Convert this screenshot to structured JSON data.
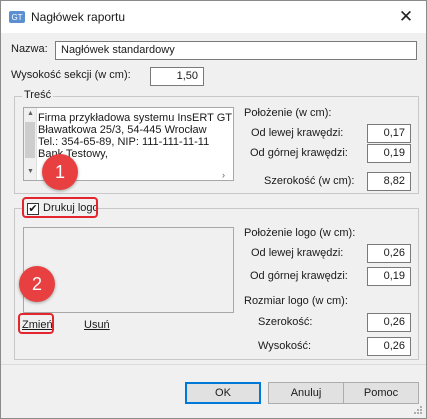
{
  "window": {
    "title": "Nagłówek raportu",
    "close_glyph": "✕",
    "app_icon": "app-icon"
  },
  "header": {
    "name_label": "Nazwa:",
    "name_value": "Nagłówek standardowy",
    "height_label": "Wysokość sekcji (w cm):",
    "height_value": "1,50"
  },
  "content": {
    "legend": "Treść",
    "lines": [
      "Firma przykładowa systemu InsERT GT",
      "Bławatkowa 25/3, 54-445 Wrocław",
      "Tel.: 354-65-89, NIP: 111-111-11-11",
      "Bank Testowy,"
    ],
    "position_label": "Położenie (w cm):",
    "left_label": "Od lewej krawędzi:",
    "left_value": "0,17",
    "top_label": "Od górnej krawędzi:",
    "top_value": "0,19",
    "width_label": "Szerokość (w cm):",
    "width_value": "8,82"
  },
  "logo": {
    "print_label": "Drukuj logo",
    "checked": true,
    "check_glyph": "✔",
    "position_label": "Położenie logo (w cm):",
    "left_label": "Od lewej krawędzi:",
    "left_value": "0,26",
    "top_label": "Od górnej krawędzi:",
    "top_value": "0,19",
    "size_label": "Rozmiar logo (w cm):",
    "width_label": "Szerokość:",
    "width_value": "0,26",
    "height_label": "Wysokość:",
    "height_value": "0,26",
    "change_link": "Zmień",
    "remove_link": "Usuń"
  },
  "annotations": {
    "badge1": "1",
    "badge2": "2",
    "color": "#e3262e"
  },
  "buttons": {
    "ok": "OK",
    "cancel": "Anuluj",
    "help": "Pomoc"
  }
}
